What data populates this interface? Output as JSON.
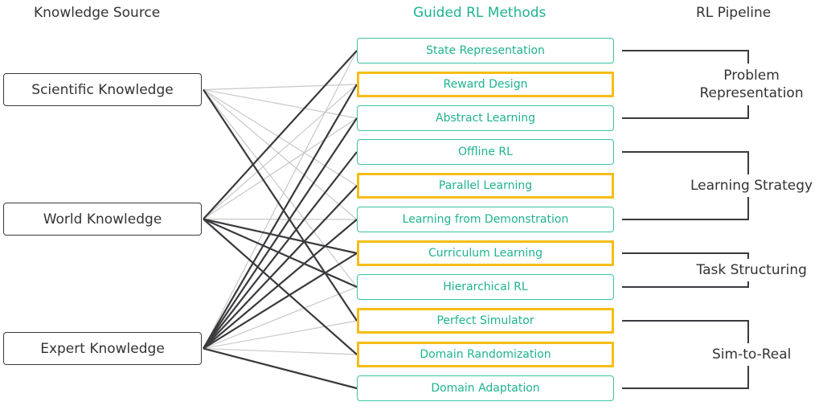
{
  "titles": {
    "source": "Knowledge Source",
    "methods": "Guided RL Methods",
    "pipeline": "RL Pipeline"
  },
  "colors": {
    "method_text": "#1fb390",
    "teal_border": "#3cc4a2",
    "gold_border": "#f6bd16",
    "dark_line": "#3a3a3e",
    "light_line": "#c8c8c8"
  },
  "sources": [
    {
      "id": "sci",
      "label": "Scientific Knowledge"
    },
    {
      "id": "world",
      "label": "World Knowledge"
    },
    {
      "id": "expert",
      "label": "Expert Knowledge"
    }
  ],
  "methods": [
    {
      "label": "State Representation",
      "style": "teal"
    },
    {
      "label": "Reward Design",
      "style": "gold"
    },
    {
      "label": "Abstract Learning",
      "style": "teal"
    },
    {
      "label": "Offline RL",
      "style": "teal"
    },
    {
      "label": "Parallel Learning",
      "style": "gold"
    },
    {
      "label": "Learning from Demonstration",
      "style": "teal"
    },
    {
      "label": "Curriculum Learning",
      "style": "gold"
    },
    {
      "label": "Hierarchical RL",
      "style": "teal"
    },
    {
      "label": "Perfect Simulator",
      "style": "gold"
    },
    {
      "label": "Domain Randomization",
      "style": "gold"
    },
    {
      "label": "Domain Adaptation",
      "style": "teal"
    }
  ],
  "pipeline": [
    {
      "label_lines": [
        "Problem",
        "Representation"
      ],
      "methods": [
        0,
        2
      ]
    },
    {
      "label_lines": [
        "Learning Strategy"
      ],
      "methods": [
        3,
        5
      ]
    },
    {
      "label_lines": [
        "Task Structuring"
      ],
      "methods": [
        6,
        7
      ]
    },
    {
      "label_lines": [
        "Sim-to-Real"
      ],
      "methods": [
        8,
        10
      ]
    }
  ],
  "links": [
    {
      "source": 0,
      "method": 1,
      "strength": "light"
    },
    {
      "source": 0,
      "method": 2,
      "strength": "light"
    },
    {
      "source": 0,
      "method": 4,
      "strength": "light"
    },
    {
      "source": 0,
      "method": 5,
      "strength": "light"
    },
    {
      "source": 0,
      "method": 7,
      "strength": "light"
    },
    {
      "source": 0,
      "method": 8,
      "strength": "dark"
    },
    {
      "source": 1,
      "method": 0,
      "strength": "dark"
    },
    {
      "source": 1,
      "method": 1,
      "strength": "light"
    },
    {
      "source": 1,
      "method": 2,
      "strength": "light"
    },
    {
      "source": 1,
      "method": 5,
      "strength": "light"
    },
    {
      "source": 1,
      "method": 6,
      "strength": "dark"
    },
    {
      "source": 1,
      "method": 7,
      "strength": "dark"
    },
    {
      "source": 1,
      "method": 9,
      "strength": "dark"
    },
    {
      "source": 2,
      "method": 0,
      "strength": "light"
    },
    {
      "source": 2,
      "method": 1,
      "strength": "dark"
    },
    {
      "source": 2,
      "method": 2,
      "strength": "dark"
    },
    {
      "source": 2,
      "method": 3,
      "strength": "dark"
    },
    {
      "source": 2,
      "method": 4,
      "strength": "dark"
    },
    {
      "source": 2,
      "method": 5,
      "strength": "dark"
    },
    {
      "source": 2,
      "method": 6,
      "strength": "dark"
    },
    {
      "source": 2,
      "method": 7,
      "strength": "light"
    },
    {
      "source": 2,
      "method": 8,
      "strength": "light"
    },
    {
      "source": 2,
      "method": 9,
      "strength": "light"
    },
    {
      "source": 2,
      "method": 10,
      "strength": "dark"
    }
  ]
}
